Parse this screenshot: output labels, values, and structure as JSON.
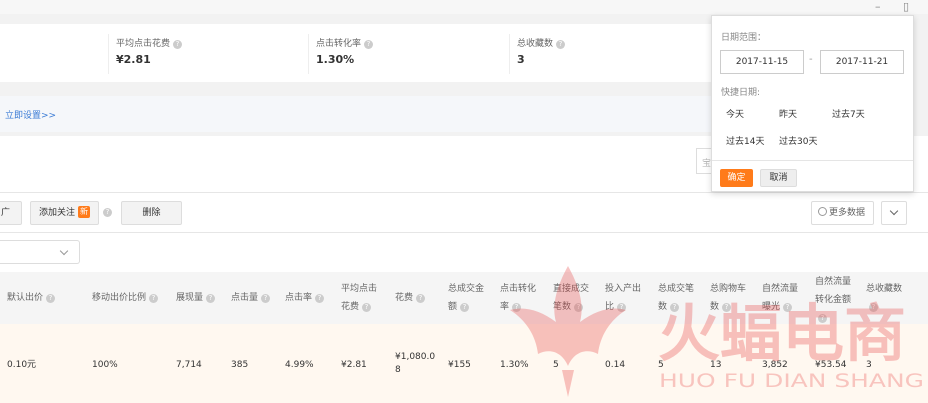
{
  "window": {
    "minimize": "–",
    "restore": "▯"
  },
  "stats": {
    "avg_cpc": {
      "label": "平均点击花费",
      "value": "¥2.81"
    },
    "cvr": {
      "label": "点击转化率",
      "value": "1.30%"
    },
    "favorites": {
      "label": "总收藏数",
      "value": "3"
    }
  },
  "notice": {
    "link": "立即设置>>"
  },
  "search": {
    "placeholder_fragment": "宝"
  },
  "toolbar": {
    "promote_fragment": "广",
    "add_follow": "添加关注",
    "new_badge": "新",
    "delete": "删除",
    "more_data": "更多数据"
  },
  "table": {
    "headers": {
      "default_bid": "默认出价",
      "mobile_bid_ratio": "移动出价比例",
      "impressions": "展现量",
      "clicks": "点击量",
      "ctr": "点击率",
      "avg_cpc_l1": "平均点击",
      "avg_cpc_l2": "花费",
      "cost": "花费",
      "gmv_l1": "总成交金",
      "gmv_l2": "额",
      "cvr_l1": "点击转化",
      "cvr_l2": "率",
      "direct_orders_l1": "直接成交",
      "direct_orders_l2": "笔数",
      "roi_l1": "投入产出",
      "roi_l2": "比",
      "total_orders_l1": "总成交笔",
      "total_orders_l2": "数",
      "cart_l1": "总购物车",
      "cart_l2": "数",
      "organic_imp_l1": "自然流量",
      "organic_imp_l2": "曝光",
      "organic_gmv_l1": "自然流量",
      "organic_gmv_l2": "转化金额",
      "favorites": "总收藏数"
    },
    "row": {
      "default_bid": "0.10元",
      "mobile_bid_ratio": "100%",
      "impressions": "7,714",
      "clicks": "385",
      "ctr": "4.99%",
      "avg_cpc": "¥2.81",
      "cost_l1": "¥1,080.0",
      "cost_l2": "8",
      "gmv": "¥155",
      "cvr": "1.30%",
      "direct_orders": "5",
      "roi": "0.14",
      "total_orders": "5",
      "cart": "13",
      "organic_imp": "3,852",
      "organic_gmv": "¥53.54",
      "favorites": "3"
    }
  },
  "watermark": {
    "cn": "火蝠电商",
    "en": "HUO FU DIAN SHANG"
  },
  "date_popup": {
    "range_label": "日期范围：",
    "start": "2017-11-15",
    "dash": "-",
    "end": "2017-11-21",
    "quick_label": "快捷日期:",
    "quick": [
      "今天",
      "昨天",
      "过去7天",
      "过去14天",
      "过去30天"
    ],
    "ok": "确定",
    "cancel": "取消"
  },
  "colors": {
    "accent": "#ff7b1a",
    "link": "#3a7bd5",
    "watermark": "#e84c4c"
  }
}
